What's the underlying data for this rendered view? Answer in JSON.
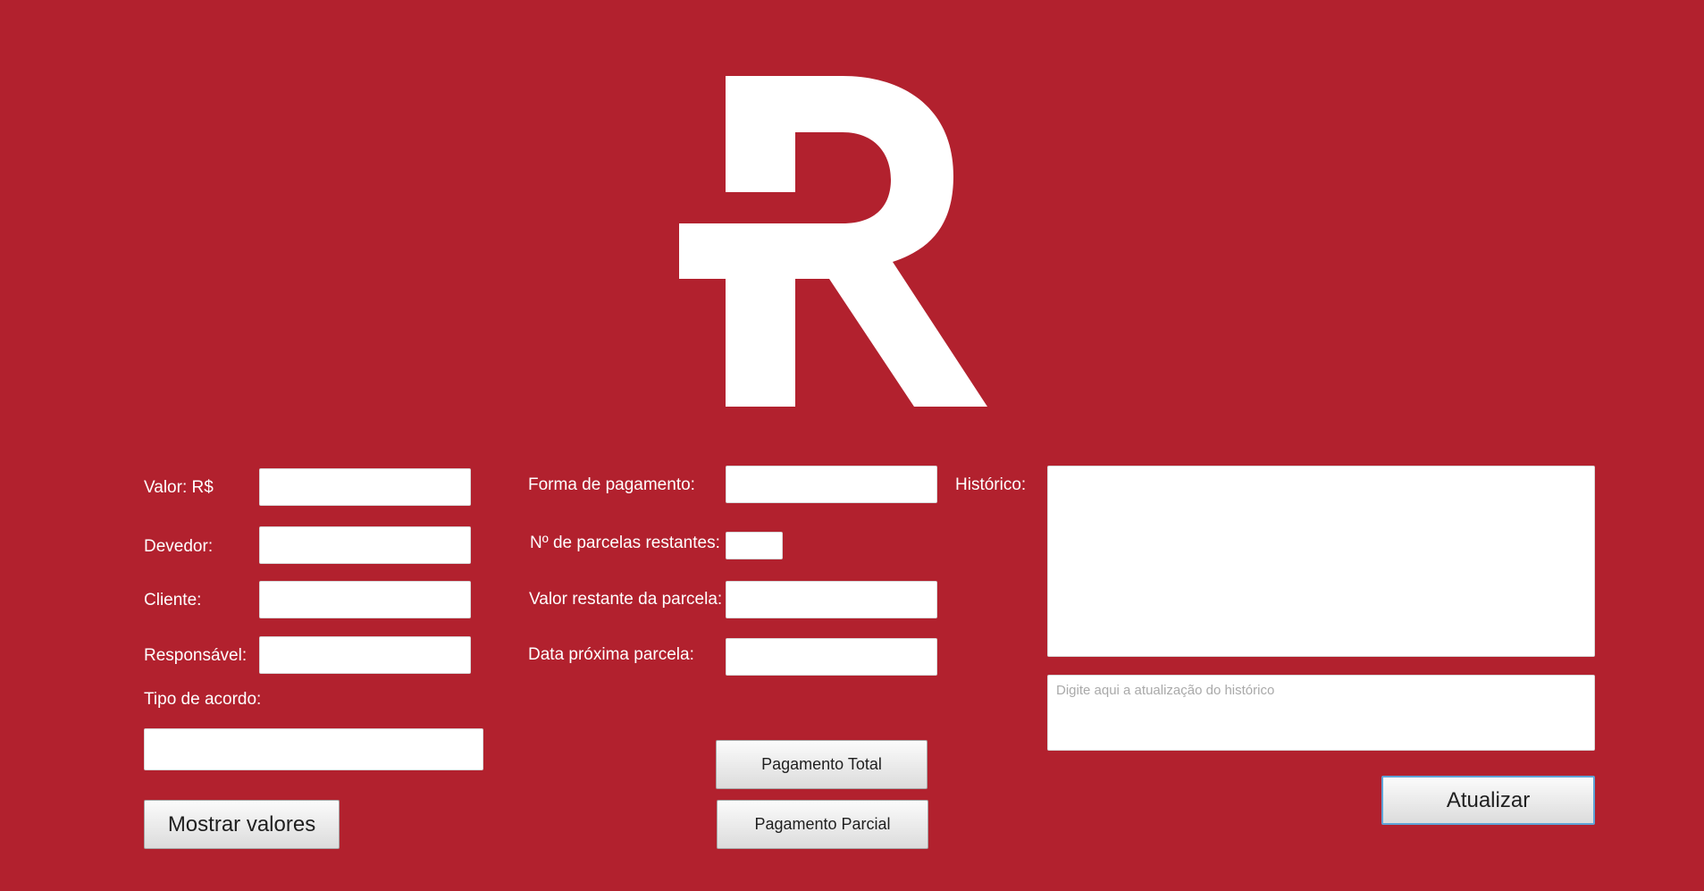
{
  "logo": {
    "name": "r-logo",
    "color": "#ffffff"
  },
  "colors": {
    "background": "#b2212e",
    "field_background": "#ffffff",
    "label_text": "#ffffff",
    "button_focus_border": "#5fa3d6"
  },
  "left": {
    "valor_label": "Valor: R$",
    "devedor_label": "Devedor:",
    "cliente_label": "Cliente:",
    "responsavel_label": "Responsável:",
    "tipo_acordo_label": "Tipo de acordo:",
    "valor_value": "",
    "devedor_value": "",
    "cliente_value": "",
    "responsavel_value": "",
    "tipo_acordo_value": "",
    "mostrar_valores_button": "Mostrar valores"
  },
  "middle": {
    "forma_pagamento_label": "Forma de pagamento:",
    "parcelas_restantes_label": "Nº de parcelas restantes:",
    "valor_restante_label": "Valor restante da parcela:",
    "data_proxima_label": "Data próxima parcela:",
    "forma_pagamento_value": "",
    "parcelas_restantes_value": "",
    "valor_restante_value": "",
    "data_proxima_value": "",
    "pagamento_total_button": "Pagamento Total",
    "pagamento_parcial_button": "Pagamento Parcial"
  },
  "right": {
    "historico_label": "Histórico:",
    "historico_value": "",
    "atualizacao_placeholder": "Digite aqui a atualização do histórico",
    "atualizacao_value": "",
    "atualizar_button": "Atualizar"
  }
}
